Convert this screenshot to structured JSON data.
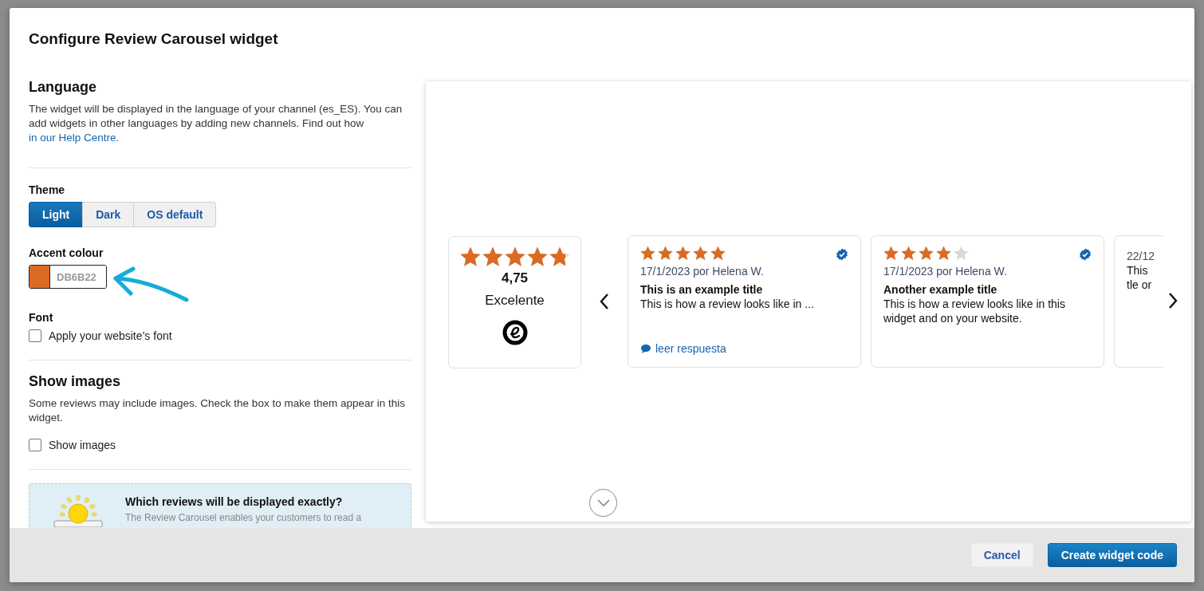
{
  "dialog": {
    "title": "Configure Review Carousel widget"
  },
  "language": {
    "heading": "Language",
    "text": "The widget will be displayed in the language of your channel (es_ES). You can add widgets in other languages by adding new channels. Find out how",
    "link": "in our Help Centre."
  },
  "theme": {
    "label": "Theme",
    "options": [
      {
        "label": "Light",
        "selected": true
      },
      {
        "label": "Dark",
        "selected": false
      },
      {
        "label": "OS default",
        "selected": false
      }
    ]
  },
  "accent": {
    "label": "Accent colour",
    "color": "#db6b22",
    "value": "DB6B22"
  },
  "font": {
    "label": "Font",
    "checkbox": {
      "label": "Apply your website’s font",
      "checked": false
    }
  },
  "images": {
    "heading": "Show images",
    "text": "Some reviews may include images. Check the box to make them appear in this widget.",
    "checkbox": {
      "label": "Show images",
      "checked": false
    }
  },
  "info": {
    "title": "Which reviews will be displayed exactly?",
    "text": "The Review Carousel enables your customers to read a"
  },
  "preview": {
    "summary": {
      "stars": 4.75,
      "score": "4,75",
      "label": "Excelente"
    },
    "reviews": [
      {
        "stars": 5,
        "date": "17/1/2023 por Helena W.",
        "title": "This is an example title",
        "body": "This is how a review looks like in ...",
        "verified": true,
        "reply": "leer respuesta"
      },
      {
        "stars": 4,
        "date": "17/1/2023 por Helena W.",
        "title": "Another example title",
        "body": "This is how a review looks like in this widget and on your website.",
        "verified": true
      },
      {
        "date": "22/12",
        "body": "This\ntle or"
      }
    ]
  },
  "buttons": [
    {
      "label": "Cancel",
      "kind": "secondary"
    },
    {
      "label": "Create widget code",
      "kind": "primary"
    }
  ]
}
